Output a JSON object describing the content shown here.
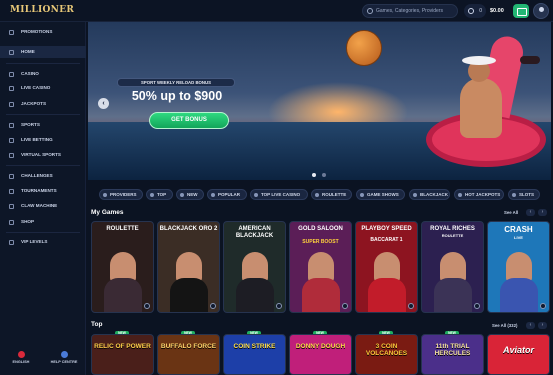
{
  "header": {
    "logo": "MILLIONER",
    "search_placeholder": "Games, Categories, Providers",
    "coins": "0",
    "balance": "$0.00"
  },
  "sidebar": {
    "items": [
      {
        "label": "PROMOTIONS",
        "icon": "gift-icon"
      },
      {
        "label": "HOME",
        "icon": "home-icon",
        "active": true
      },
      {
        "label": "CASINO",
        "icon": "diamond-icon"
      },
      {
        "label": "LIVE CASINO",
        "icon": "cards-icon"
      },
      {
        "label": "JACKPOTS",
        "icon": "trophy-icon"
      },
      {
        "label": "SPORTS",
        "icon": "ball-icon"
      },
      {
        "label": "LIVE BETTING",
        "icon": "clock-icon"
      },
      {
        "label": "VIRTUAL SPORTS",
        "icon": "controller-icon"
      },
      {
        "label": "CHALLENGES",
        "icon": "flag-icon"
      },
      {
        "label": "TOURNAMENTS",
        "icon": "cup-icon"
      },
      {
        "label": "CLAW MACHINE",
        "icon": "claw-icon"
      },
      {
        "label": "SHOP",
        "icon": "bag-icon"
      },
      {
        "label": "VIP LEVELS",
        "icon": "crown-icon"
      }
    ],
    "footer": [
      {
        "label": "ENGLISH",
        "icon": "flag-canada-icon",
        "color": "#d9293b"
      },
      {
        "label": "HELP CENTRE",
        "icon": "help-icon",
        "color": "#4a7bd8"
      }
    ]
  },
  "hero": {
    "badge": "SPORT WEEKLY RELOAD BONUS",
    "headline": "50% up to $900",
    "cta": "GET BONUS"
  },
  "categories": [
    "PROVIDERS",
    "TOP",
    "NEW",
    "POPULAR",
    "TOP LIVE CASINO",
    "ROULETTE",
    "GAME SHOWS",
    "BLACKJACK",
    "HOT JACKPOTS",
    "SLOTS"
  ],
  "my_games": {
    "title": "My Games",
    "see_all": "See All",
    "tiles": [
      {
        "name": "ROULETTE",
        "sub": "",
        "bg": "#2a1d1c",
        "body": "#3a2a34"
      },
      {
        "name": "BLACKJACK ORO 2",
        "sub": "",
        "bg": "#3b2d25",
        "body": "#141414"
      },
      {
        "name": "AMERICAN BLACKJACK",
        "sub": "",
        "bg": "#1f2b2a",
        "body": "#1d1d24"
      },
      {
        "name": "GOLD SALOON",
        "sub": "SUPER BOOST",
        "bg": "#5b1e57",
        "body": "#b02c3a"
      },
      {
        "name": "PLAYBOY SPEED",
        "sub": "BACCARAT 1",
        "bg": "#8d1420",
        "body": "#c21c2a"
      },
      {
        "name": "ROYAL RICHES",
        "sub": "ROULETTE",
        "bg": "#2c2050",
        "body": "#3b3356"
      },
      {
        "name": "CRASH",
        "sub": "LIVE",
        "bg": "#1e77b9",
        "body": "#3a55b0"
      }
    ]
  },
  "top": {
    "title": "Top",
    "see_all": "See All (332)",
    "badge": "NEW",
    "tiles": [
      {
        "name": "RELIC OF POWER",
        "bg": "#4a1f1a"
      },
      {
        "name": "BUFFALO FORCE",
        "bg": "#6a3414"
      },
      {
        "name": "COIN STRIKE",
        "bg": "#1d3fa8"
      },
      {
        "name": "DONNY DOUGH",
        "bg": "#c01f7a"
      },
      {
        "name": "3 COIN VOLCANOES",
        "bg": "#7a1b12"
      },
      {
        "name": "11th TRIAL HERCULES",
        "bg": "#4b2f8a"
      },
      {
        "name": "Aviator",
        "bg": "#d92437"
      }
    ]
  }
}
